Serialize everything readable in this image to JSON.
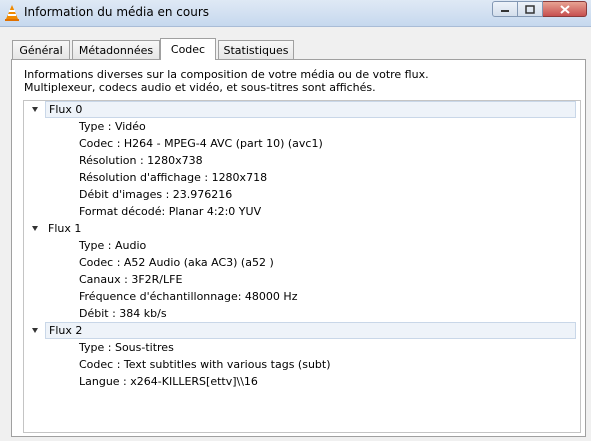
{
  "window": {
    "title": "Information du média en cours"
  },
  "tabs": [
    {
      "label": "Général",
      "active": false
    },
    {
      "label": "Métadonnées",
      "active": false
    },
    {
      "label": "Codec",
      "active": true
    },
    {
      "label": "Statistiques",
      "active": false
    }
  ],
  "description": {
    "line1": "Informations diverses sur la composition de votre média ou de votre flux.",
    "line2": "Multiplexeur, codecs audio et vidéo, et sous-titres sont affichés."
  },
  "streams": [
    {
      "label": "Flux 0",
      "items": [
        "Type : Vidéo",
        "Codec : H264 - MPEG-4 AVC (part 10) (avc1)",
        "Résolution : 1280x738",
        "Résolution d'affichage : 1280x718",
        "Débit d'images : 23.976216",
        "Format décodé: Planar 4:2:0 YUV"
      ]
    },
    {
      "label": "Flux 1",
      "items": [
        "Type : Audio",
        "Codec : A52 Audio (aka AC3) (a52 )",
        "Canaux : 3F2R/LFE",
        "Fréquence d'échantillonnage: 48000 Hz",
        "Débit : 384 kb/s"
      ]
    },
    {
      "label": "Flux 2",
      "items": [
        "Type : Sous-titres",
        "Codec : Text subtitles with various tags (subt)",
        "Langue : x264-KILLERS[ettv]\\\\16"
      ]
    }
  ]
}
